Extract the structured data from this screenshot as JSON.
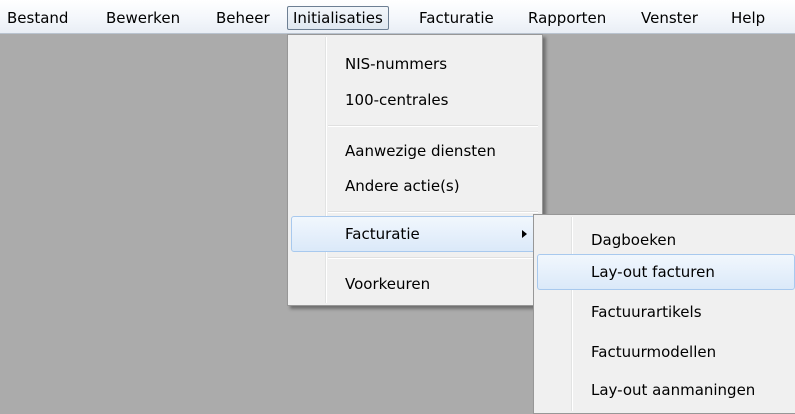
{
  "menubar": {
    "items": [
      {
        "label": "Bestand"
      },
      {
        "label": "Bewerken"
      },
      {
        "label": "Beheer"
      },
      {
        "label": "Initialisaties"
      },
      {
        "label": "Facturatie"
      },
      {
        "label": "Rapporten"
      },
      {
        "label": "Venster"
      },
      {
        "label": "Help"
      }
    ]
  },
  "initialisaties_menu": {
    "items": [
      {
        "label": "NIS-nummers"
      },
      {
        "label": "100-centrales"
      },
      {
        "label": "Aanwezige diensten"
      },
      {
        "label": "Andere actie(s)"
      },
      {
        "label": "Facturatie"
      },
      {
        "label": "Voorkeuren"
      }
    ]
  },
  "facturatie_submenu": {
    "items": [
      {
        "label": "Dagboeken"
      },
      {
        "label": "Lay-out facturen"
      },
      {
        "label": "Factuurartikels"
      },
      {
        "label": "Factuurmodellen"
      },
      {
        "label": "Lay-out aanmaningen"
      }
    ]
  },
  "icons": {
    "submenu_arrow": "chevron-right-icon"
  },
  "colors": {
    "workspace": "#ababab",
    "menu_background": "#f0f0f0",
    "highlight_border": "#a8c9ee",
    "highlight_fill": "#dbe9f9"
  }
}
